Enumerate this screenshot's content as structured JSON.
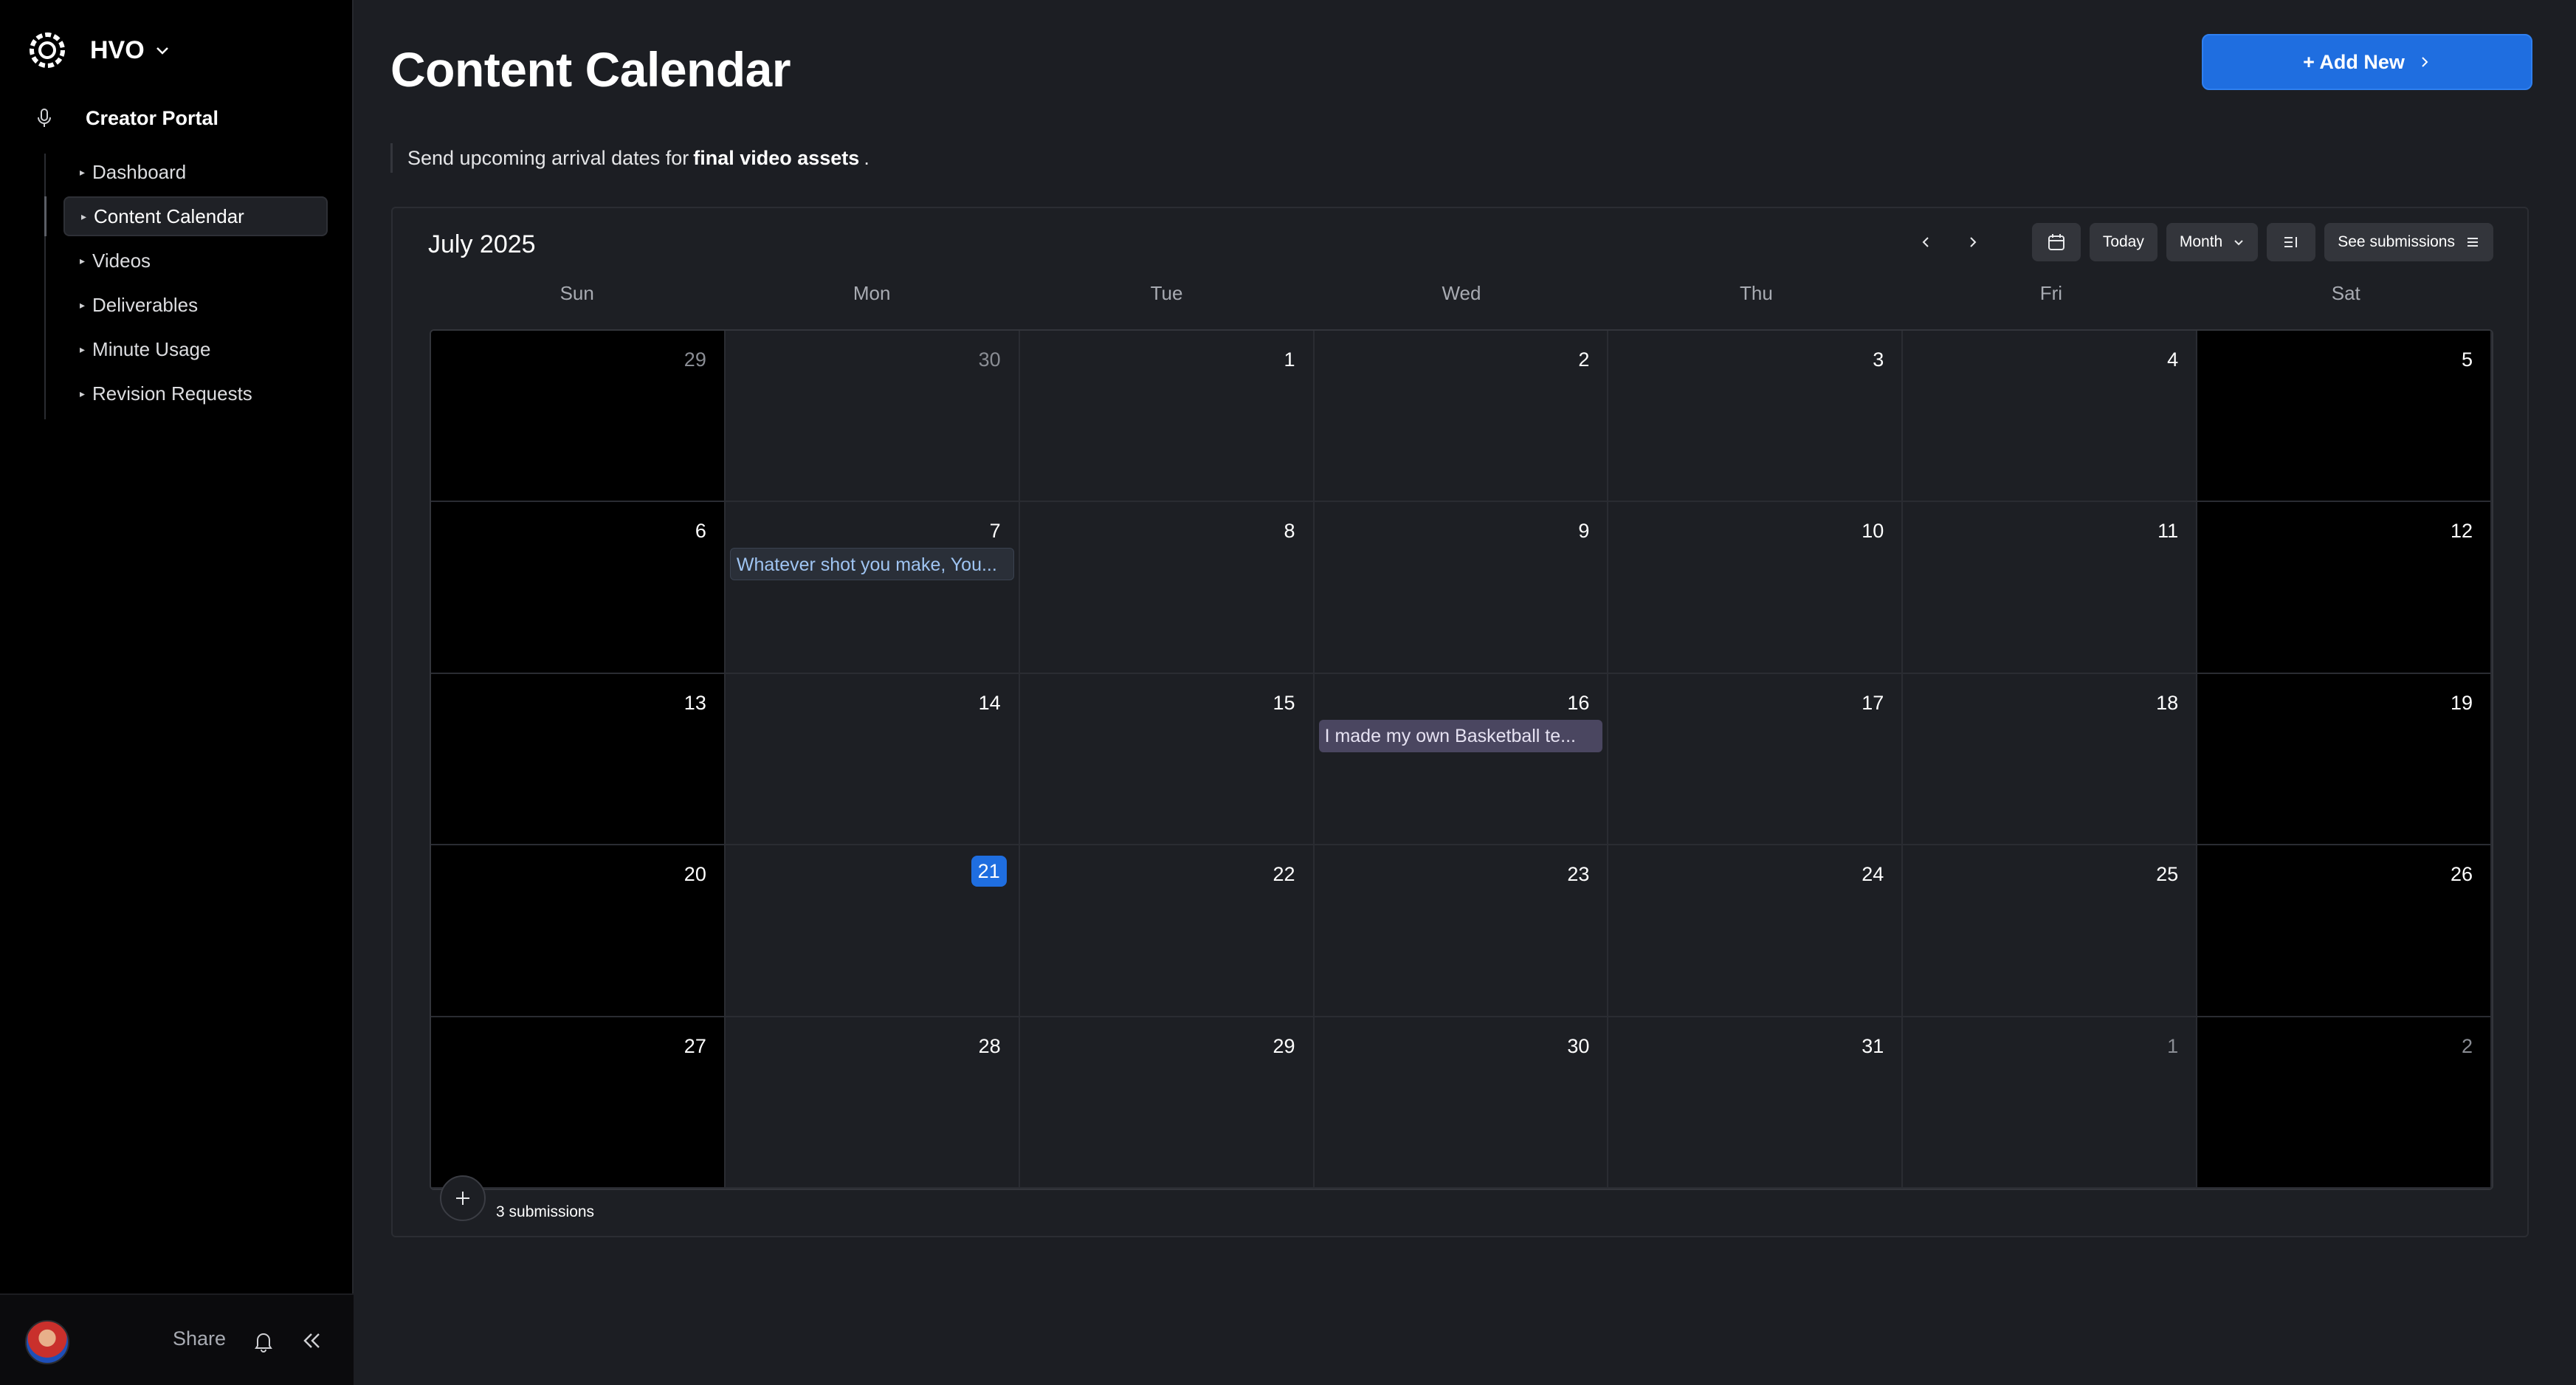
{
  "workspace": {
    "name": "HVO"
  },
  "sidebar": {
    "section_label": "Creator Portal",
    "items": [
      {
        "label": "Dashboard",
        "active": false
      },
      {
        "label": "Content Calendar",
        "active": true
      },
      {
        "label": "Videos",
        "active": false
      },
      {
        "label": "Deliverables",
        "active": false
      },
      {
        "label": "Minute Usage",
        "active": false
      },
      {
        "label": "Revision Requests",
        "active": false
      }
    ],
    "footer": {
      "share_label": "Share"
    }
  },
  "header": {
    "title": "Content Calendar",
    "add_button_label": "+ Add New",
    "subtitle_prefix": "Send upcoming arrival dates for",
    "subtitle_bold": "final video assets",
    "subtitle_suffix": "."
  },
  "calendar": {
    "month_label": "July 2025",
    "today_label": "Today",
    "view_label": "Month",
    "submissions_label": "See submissions",
    "weekdays": [
      "Sun",
      "Mon",
      "Tue",
      "Wed",
      "Thu",
      "Fri",
      "Sat"
    ],
    "weeks": [
      [
        "29",
        "30",
        "1",
        "2",
        "3",
        "4",
        "5"
      ],
      [
        "6",
        "7",
        "8",
        "9",
        "10",
        "11",
        "12"
      ],
      [
        "13",
        "14",
        "15",
        "16",
        "17",
        "18",
        "19"
      ],
      [
        "20",
        "21",
        "22",
        "23",
        "24",
        "25",
        "26"
      ],
      [
        "27",
        "28",
        "29",
        "30",
        "31",
        "1",
        "2"
      ]
    ],
    "muted_cells": [
      "0-0",
      "0-1",
      "4-5",
      "4-6"
    ],
    "today_cell": "3-1",
    "events": [
      {
        "cell": "1-1",
        "title": "Whatever shot you make, You...",
        "color": "blue"
      },
      {
        "cell": "2-3",
        "title": "I made my own Basketball te...",
        "color": "purple"
      }
    ],
    "footer_count": "3 submissions"
  },
  "colors": {
    "accent": "#1f6ee0",
    "background": "#1c1e23",
    "sidebar": "#000000",
    "weekend_cell": "#000000",
    "event_blue_text": "#9fc4f2",
    "event_purple_bg": "#4a4660"
  },
  "icons": {
    "workspace_logo": "logo-ring-icon",
    "portal": "microphone-icon",
    "bell": "bell-icon",
    "collapse": "double-chevron-left-icon",
    "calendar": "calendar-icon",
    "list": "list-icon"
  }
}
